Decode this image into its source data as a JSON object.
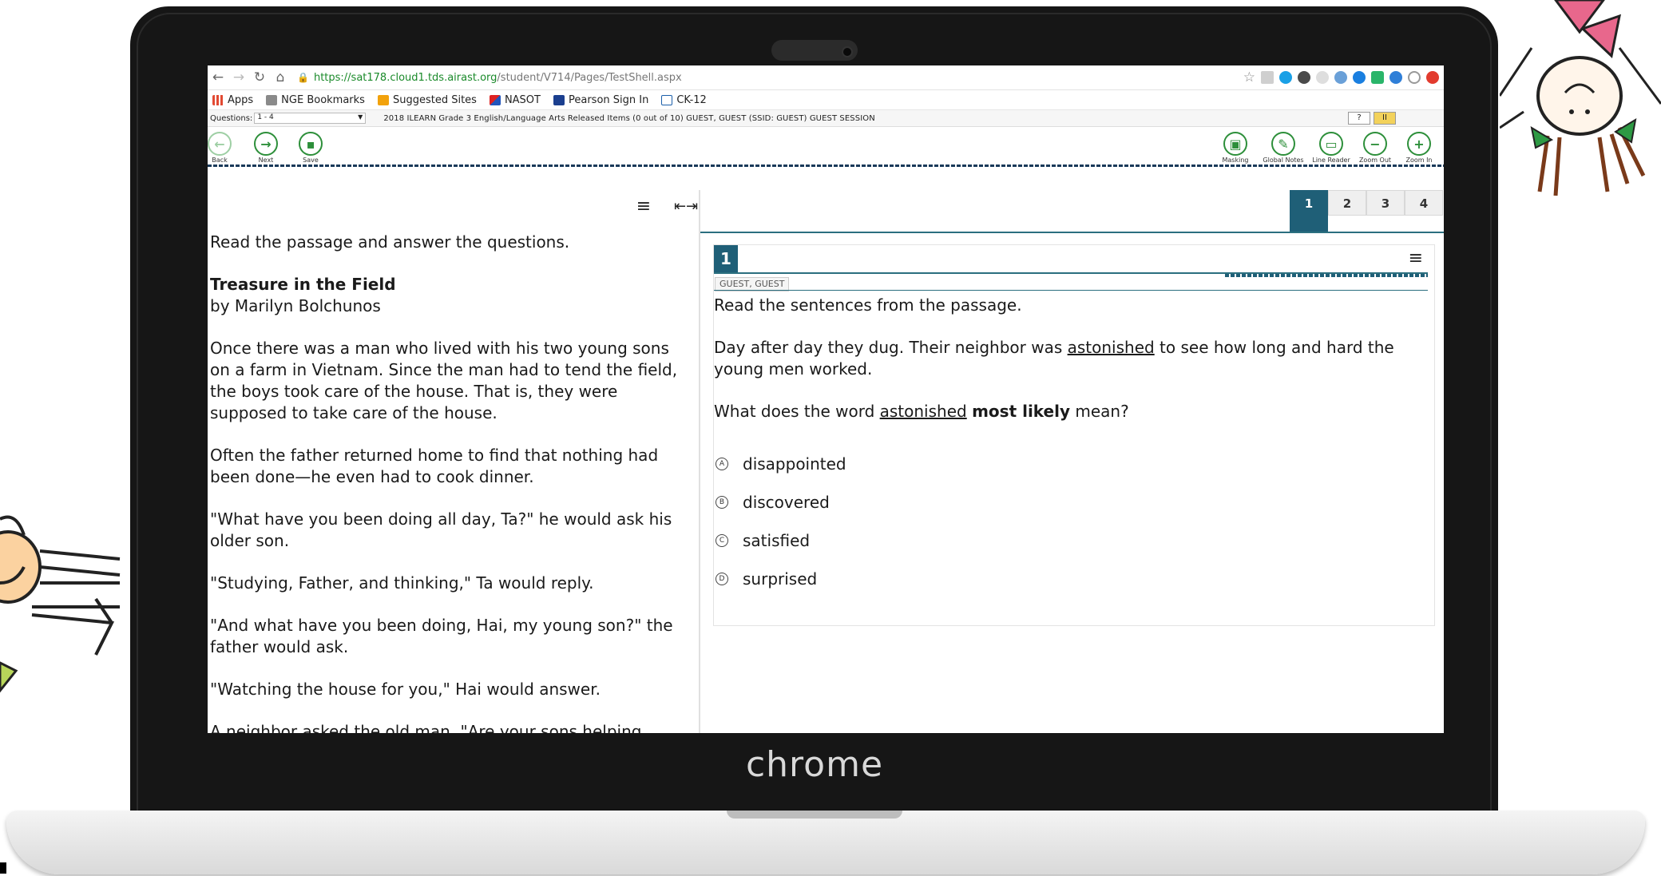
{
  "brand": "chrome",
  "browser": {
    "url_host": "https://sat178.cloud1.tds.airast.org",
    "url_path": "/student/V714/Pages/TestShell.aspx",
    "bookmarks": [
      "Apps",
      "NGE Bookmarks",
      "Suggested Sites",
      "NASOT",
      "Pearson Sign In",
      "CK-12"
    ]
  },
  "test_header": {
    "questions_label": "Questions:",
    "questions_value": "1 - 4",
    "test_info": "2018 ILEARN Grade 3 English/Language Arts Released Items (0 out of 10)   GUEST, GUEST (SSID: GUEST)   GUEST  SESSION",
    "help_label": "?",
    "pause_label": "II"
  },
  "toolbar": {
    "back": "Back",
    "next": "Next",
    "save": "Save",
    "masking": "Masking",
    "global_notes": "Global Notes",
    "line_reader": "Line Reader",
    "zoom_out": "Zoom Out",
    "zoom_in": "Zoom In"
  },
  "passage": {
    "intro": "Read the passage and answer the questions.",
    "title": "Treasure in the Field",
    "byline": "by Marilyn Bolchunos",
    "paragraphs": [
      "Once there was a man who lived with his two young sons on a farm in Vietnam. Since the man had to tend the field, the boys took care of the house. That is, they were supposed to take care of the house.",
      "Often the father returned home to find that nothing had been done—he even had to cook dinner.",
      "\"What have you been doing all day, Ta?\" he would ask his older son.",
      "\"Studying, Father, and thinking,\" Ta would reply.",
      "\"And what have you been doing, Hai, my young son?\" the father would ask.",
      "\"Watching the house for you,\" Hai would answer.",
      "A neighbor asked the old man, \"Are your sons helping"
    ]
  },
  "question_tabs": [
    "1",
    "2",
    "3",
    "4"
  ],
  "item": {
    "number": "1",
    "student": "GUEST, GUEST",
    "prompt": "Read the sentences from the passage.",
    "sentence_pre": "Day after day they dug. Their neighbor was ",
    "sentence_word": "astonished",
    "sentence_post": " to see how long and hard the young men worked.",
    "question_pre": "What does the word ",
    "question_word": "astonished",
    "question_bold": "most likely",
    "question_post": " mean?",
    "options": [
      {
        "letter": "A",
        "text": "disappointed"
      },
      {
        "letter": "B",
        "text": "discovered"
      },
      {
        "letter": "C",
        "text": "satisfied"
      },
      {
        "letter": "D",
        "text": "surprised"
      }
    ]
  },
  "colors": {
    "accent_green": "#2d8f3a",
    "tab_active": "#1f5f77",
    "laptop_bezel": "#161616"
  }
}
